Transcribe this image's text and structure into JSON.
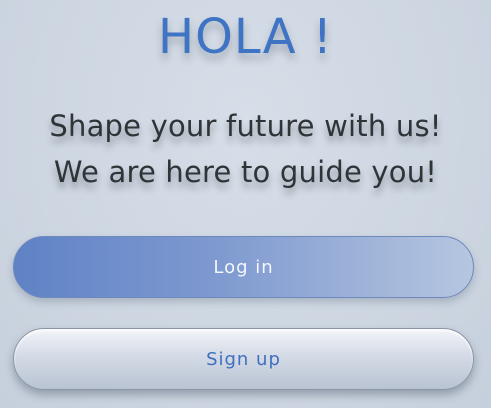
{
  "welcome": {
    "title": "HOLA !",
    "tagline_line1": "Shape your future with us!",
    "tagline_line2": "We are here to guide you!"
  },
  "buttons": {
    "login_label": "Log in",
    "signup_label": "Sign up"
  },
  "colors": {
    "title": "#3f73c4",
    "login_start": "#5f82c6",
    "login_end": "#b6c6e0",
    "signup_text": "#3f6fbe",
    "background": "#cfd8e3"
  }
}
